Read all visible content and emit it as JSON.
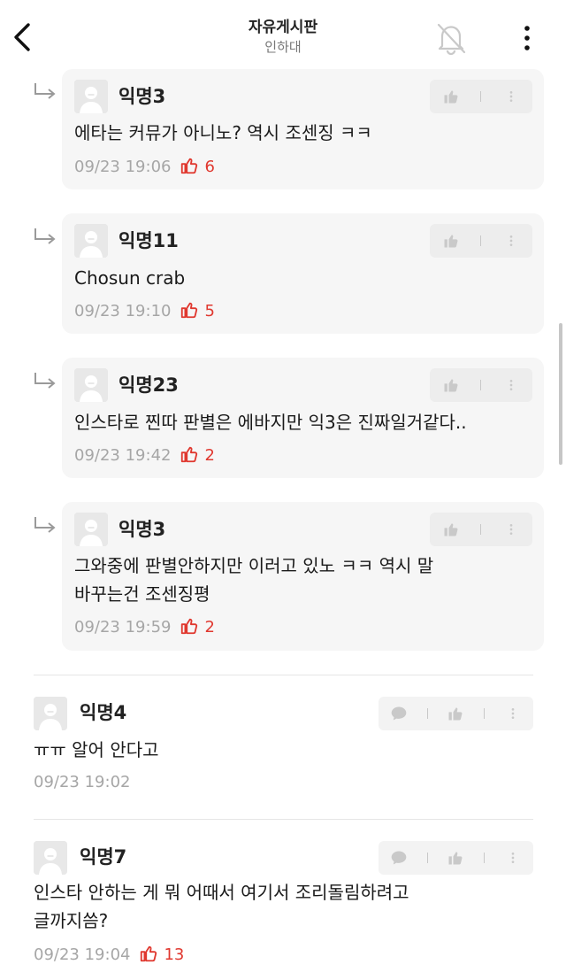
{
  "header": {
    "title": "자유게시판",
    "subtitle": "인하대",
    "back_icon": "chevron-left-icon",
    "bell_icon": "bell-off-icon",
    "more_icon": "more-vertical-icon"
  },
  "replies": [
    {
      "author": "익명3",
      "text": "에타는 커뮤가 아니노? 역시 조센징 ㅋㅋ",
      "time": "09/23 19:06",
      "likes": "6"
    },
    {
      "author": "익명11",
      "text": "Chosun crab",
      "time": "09/23 19:10",
      "likes": "5"
    },
    {
      "author": "익명23",
      "text": "인스타로 찐따 판별은 에바지만 익3은 진짜일거같다..",
      "time": "09/23 19:42",
      "likes": "2"
    },
    {
      "author": "익명3",
      "text_line1": "그와중에 판별안하지만 이러고 있노 ㅋㅋ 역시 말",
      "text_line2": "바꾸는건 조센징평",
      "time": "09/23 19:59",
      "likes": "2"
    }
  ],
  "comments": [
    {
      "author": "익명4",
      "text": "ㅠㅠ 알어 안다고",
      "time": "09/23 19:02"
    },
    {
      "author": "익명7",
      "text_line1": "인스타 안하는 게 뭐 어때서 여기서 조리돌림하려고",
      "text_line2": "글까지씀?",
      "time": "09/23 19:04",
      "likes": "13"
    }
  ],
  "colors": {
    "like_red": "#e0382f",
    "meta_gray": "#a6a6a6",
    "reply_bg": "#f6f6f6"
  }
}
